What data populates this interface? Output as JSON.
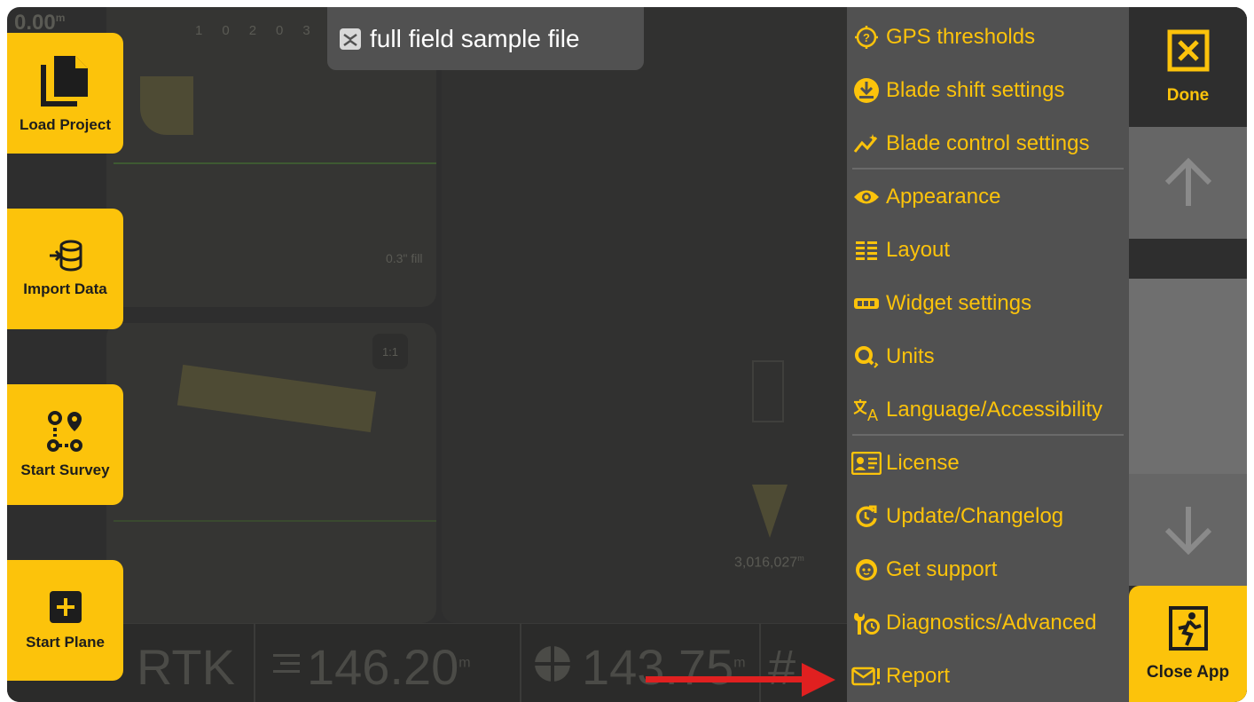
{
  "title": {
    "text": "full field sample file",
    "icon": "collapse-icon"
  },
  "background": {
    "elevation_readout": "0.00",
    "elevation_unit": "m",
    "ruler_ticks": [
      "10",
      "20",
      "30"
    ],
    "scale_badge": "1:1",
    "distance_readout": "0.3\" fill",
    "northing": "3,016,027",
    "northing_unit": "m",
    "status_rtk": "RTK",
    "value_1": "146.20",
    "value_1_unit": "m",
    "value_2": "143.75",
    "value_2_unit": "m"
  },
  "left_buttons": [
    {
      "label": "Load Project",
      "icon": "copy-files-icon"
    },
    {
      "label": "Import Data",
      "icon": "database-import-icon"
    },
    {
      "label": "Start Survey",
      "icon": "route-pins-icon"
    },
    {
      "label": "Start Plane",
      "icon": "plus-square-icon"
    }
  ],
  "menu": {
    "items": [
      {
        "label": "GPS thresholds",
        "icon": "gps-question-icon"
      },
      {
        "label": "Blade shift settings",
        "icon": "blade-shift-icon"
      },
      {
        "label": "Blade control settings",
        "icon": "sparkline-icon"
      },
      {
        "label": "Appearance",
        "icon": "eye-icon"
      },
      {
        "label": "Layout",
        "icon": "layout-list-icon"
      },
      {
        "label": "Widget settings",
        "icon": "widget-bar-icon"
      },
      {
        "label": "Units",
        "icon": "units-search-icon"
      },
      {
        "label": "Language/Accessibility",
        "icon": "translate-icon"
      },
      {
        "label": "License",
        "icon": "id-card-icon"
      },
      {
        "label": "Update/Changelog",
        "icon": "update-icon"
      },
      {
        "label": "Get support",
        "icon": "support-face-icon"
      },
      {
        "label": "Diagnostics/Advanced",
        "icon": "wrench-clock-icon"
      },
      {
        "label": "Report",
        "icon": "mail-alert-icon"
      }
    ]
  },
  "right": {
    "done_label": "Done",
    "close_label": "Close App"
  },
  "colors": {
    "accent": "#fcc30b",
    "menu_bg": "#515151",
    "app_bg": "#2e2e2e",
    "arrow": "#e02020"
  }
}
